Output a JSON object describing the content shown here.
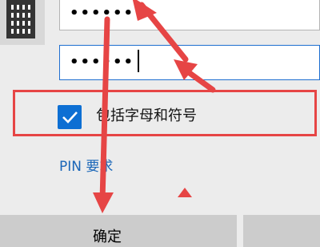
{
  "password_field": {
    "value": "••••••"
  },
  "confirm_field": {
    "value": "••••••"
  },
  "include_letters_checkbox": {
    "label": "包括字母和符号",
    "checked": true
  },
  "pin_requirements_link": {
    "label": "PIN 要求"
  },
  "ok_button": {
    "label": "确定"
  },
  "colors": {
    "accent": "#0d6fd3",
    "link": "#1a66b8",
    "annotation": "#e64545"
  },
  "icons": [
    "keypad-icon",
    "checkmark-icon"
  ]
}
